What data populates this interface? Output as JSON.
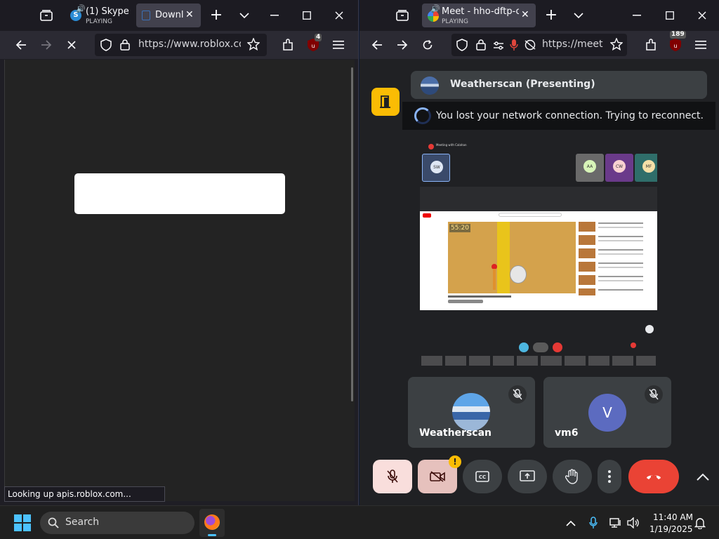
{
  "left_window": {
    "tabs": [
      {
        "title": "(1) Skype",
        "subtitle": "PLAYING"
      },
      {
        "title": "Downlo"
      }
    ],
    "url": "https://www.roblox.com",
    "extension_badge": "4",
    "status_text": "Looking up apis.roblox.com..."
  },
  "right_window": {
    "tabs": [
      {
        "title": "Meet - hho-dftp-osv",
        "subtitle": "PLAYING"
      }
    ],
    "url": "https://meet.g",
    "extension_badge": "189"
  },
  "meet": {
    "presenting_label": "Weatherscan (Presenting)",
    "toast_text": "You lost your network connection. Trying to reconnect.",
    "shared_screen": {
      "meeting_title": "Meeting with Calahan",
      "video_timer": "55:20",
      "thumbs": [
        "SW",
        "AA",
        "CW",
        "MF"
      ]
    },
    "participants": [
      {
        "name": "Weatherscan"
      },
      {
        "name": "vm6",
        "initial": "V"
      }
    ],
    "warning_badge": "!"
  },
  "taskbar": {
    "search_placeholder": "Search",
    "time": "11:40 AM",
    "date": "1/19/2025"
  },
  "colors": {
    "meet_bg": "#202124",
    "tile_bg": "#3c4043",
    "end_call": "#ea4335",
    "mic_off_bg": "#f9dedc",
    "cam_off_bg": "#e6c1bd",
    "door_button": "#fbbc04",
    "avatar_v": "#5c6bc0"
  }
}
